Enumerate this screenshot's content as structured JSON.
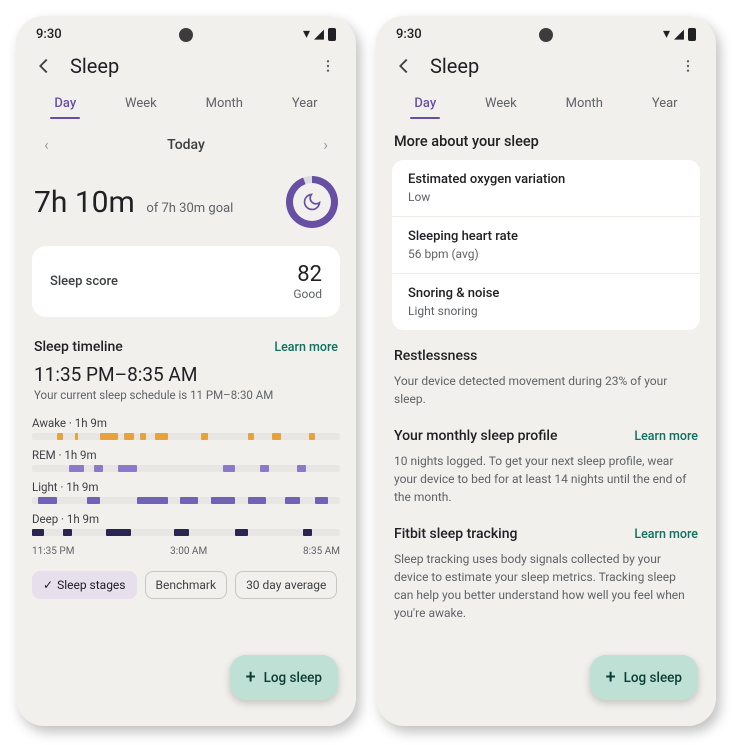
{
  "statusbar": {
    "time": "9:30"
  },
  "appbar": {
    "title": "Sleep"
  },
  "tabs": {
    "items": [
      "Day",
      "Week",
      "Month",
      "Year"
    ],
    "active": 0
  },
  "dateNav": {
    "label": "Today"
  },
  "duration": {
    "main": "7h 10m",
    "goal": "of 7h 30m goal"
  },
  "scoreCard": {
    "label": "Sleep score",
    "value": "82",
    "word": "Good"
  },
  "timeline": {
    "title": "Sleep timeline",
    "learnMore": "Learn more",
    "range": "11:35 PM–8:35 AM",
    "schedule": "Your current sleep schedule is 11 PM–8:30 AM",
    "stages": {
      "awake": "Awake · 1h 9m",
      "rem": "REM · 1h 9m",
      "light": "Light · 1h 9m",
      "deep": "Deep · 1h 9m"
    },
    "axis": {
      "t1": "11:35 PM",
      "t2": "3:00 AM",
      "t3": "8:35 AM"
    }
  },
  "chips": {
    "stages": "Sleep stages",
    "benchmark": "Benchmark",
    "avg": "30 day average"
  },
  "fab": {
    "label": "Log sleep"
  },
  "right": {
    "moreTitle": "More about your sleep",
    "oxygen": {
      "title": "Estimated oxygen variation",
      "sub": "Low"
    },
    "heart": {
      "title": "Sleeping heart rate",
      "sub": "56 bpm (avg)"
    },
    "snoring": {
      "title": "Snoring & noise",
      "sub": "Light snoring"
    },
    "restlessness": {
      "title": "Restlessness",
      "body": "Your device detected movement during 23% of your sleep."
    },
    "monthly": {
      "title": "Your monthly sleep profile",
      "learnMore": "Learn more",
      "body": "10 nights logged. To get your next sleep profile, wear your device to bed for at least 14 nights until the end of the month."
    },
    "fitbit": {
      "title": "Fitbit sleep tracking",
      "learnMore": "Learn more",
      "body": "Sleep tracking uses body signals collected by your device to estimate your sleep metrics. Tracking sleep can help you better understand how well you feel when you're awake."
    }
  }
}
